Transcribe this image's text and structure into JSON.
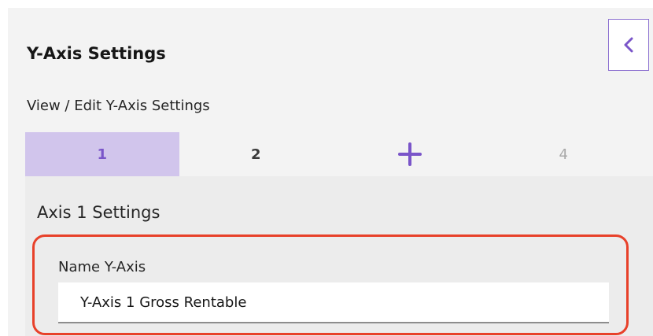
{
  "panel": {
    "title": "Y-Axis Settings",
    "subtitle": "View / Edit Y-Axis Settings",
    "collapse_icon": "chevron-left-icon"
  },
  "tabs": [
    {
      "label": "1",
      "state": "active"
    },
    {
      "label": "2",
      "state": "normal"
    },
    {
      "label": "",
      "icon": "plus-icon",
      "state": "add"
    },
    {
      "label": "4",
      "state": "disabled"
    }
  ],
  "axis_settings": {
    "heading": "Axis 1 Settings",
    "name_field": {
      "label": "Name Y-Axis",
      "value": "Y-Axis 1 Gross Rentable"
    }
  },
  "colors": {
    "accent": "#7a55c9",
    "active_tab_bg": "#d1c5ec",
    "highlight_border": "#e8412a"
  }
}
